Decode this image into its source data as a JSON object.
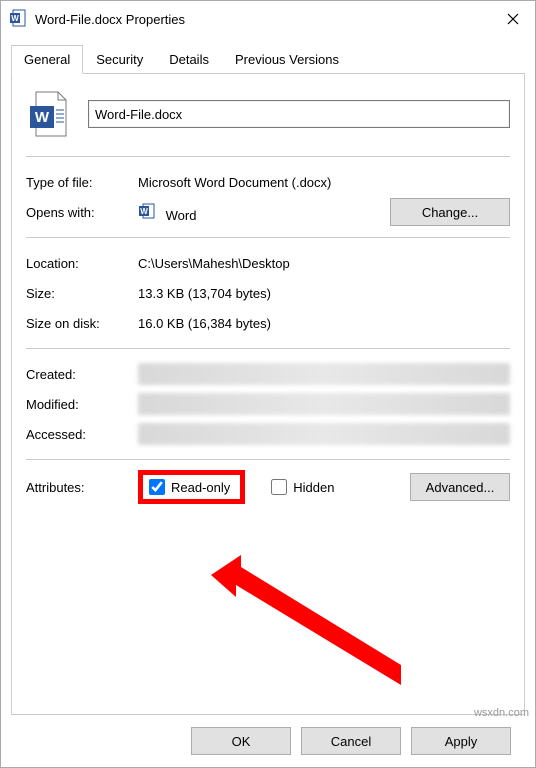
{
  "window": {
    "title": "Word-File.docx Properties"
  },
  "tabs": {
    "general": "General",
    "security": "Security",
    "details": "Details",
    "previous": "Previous Versions"
  },
  "filename": "Word-File.docx",
  "labels": {
    "typeOfFile": "Type of file:",
    "opensWith": "Opens with:",
    "location": "Location:",
    "size": "Size:",
    "sizeOnDisk": "Size on disk:",
    "created": "Created:",
    "modified": "Modified:",
    "accessed": "Accessed:",
    "attributes": "Attributes:"
  },
  "values": {
    "typeOfFile": "Microsoft Word Document (.docx)",
    "opensWithApp": "Word",
    "location": "C:\\Users\\Mahesh\\Desktop",
    "size": "13.3 KB (13,704 bytes)",
    "sizeOnDisk": "16.0 KB (16,384 bytes)"
  },
  "buttons": {
    "change": "Change...",
    "advanced": "Advanced...",
    "ok": "OK",
    "cancel": "Cancel",
    "apply": "Apply"
  },
  "checkboxes": {
    "readOnly": "Read-only",
    "hidden": "Hidden"
  },
  "watermark": "wsxdn.com"
}
